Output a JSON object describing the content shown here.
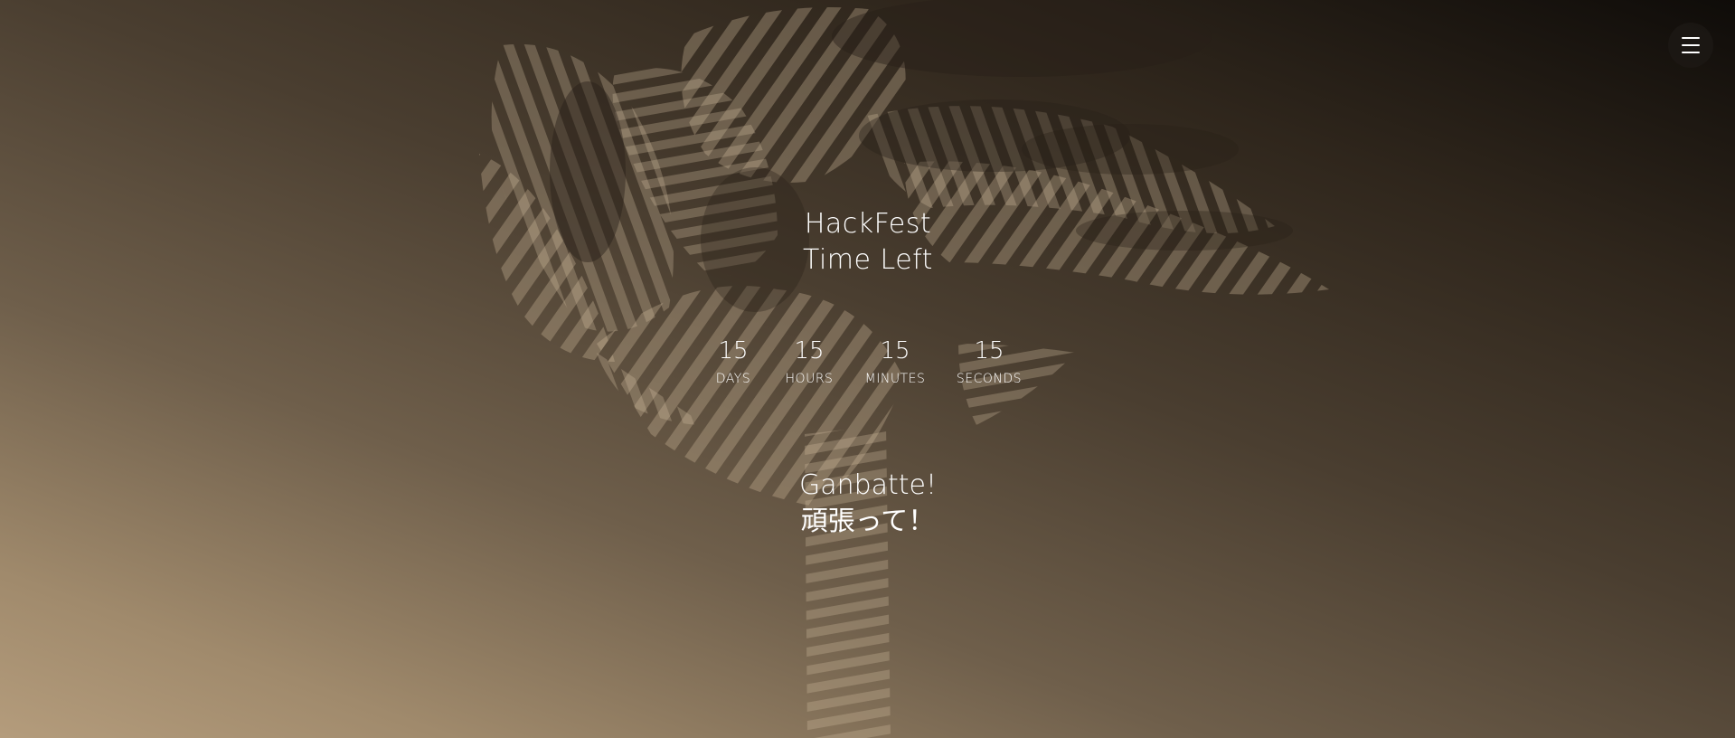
{
  "header": {
    "menu_icon": "hamburger-menu-icon"
  },
  "title": {
    "line1": "HackFest",
    "line2": "Time Left"
  },
  "countdown": {
    "days": {
      "value": "15",
      "label": "DAYS"
    },
    "hours": {
      "value": "15",
      "label": "HOURS"
    },
    "minutes": {
      "value": "15",
      "label": "MINUTES"
    },
    "seconds": {
      "value": "15",
      "label": "SECONDS"
    }
  },
  "message": {
    "line1": "Ganbatte!",
    "line2": "頑張って！"
  },
  "colors": {
    "text": "#ffffff",
    "background_dark": "#0f0c09",
    "background_light": "#b49c7c"
  }
}
